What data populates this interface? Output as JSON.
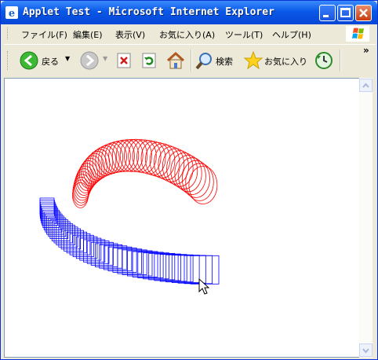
{
  "window": {
    "title": "Applet Test - Microsoft Internet Explorer"
  },
  "menu": {
    "items": [
      "ファイル(F)",
      "編集(E)",
      "表示(V)",
      "お気に入り(A)",
      "ツール(T)",
      "ヘルプ(H)"
    ]
  },
  "toolbar": {
    "back_label": "戻る",
    "search_label": "検索",
    "favorites_label": "お気に入り",
    "overflow": "»"
  },
  "icons": {
    "back": "back-arrow-icon",
    "forward": "forward-arrow-icon",
    "stop": "stop-icon",
    "refresh": "refresh-icon",
    "home": "home-icon",
    "search": "search-icon",
    "favorites": "star-icon",
    "history": "history-icon"
  },
  "colors": {
    "titlebar": "#0a58e8",
    "applet_red": "#ff0000",
    "applet_blue": "#0000ff",
    "content_bg": "#ffffff"
  }
}
